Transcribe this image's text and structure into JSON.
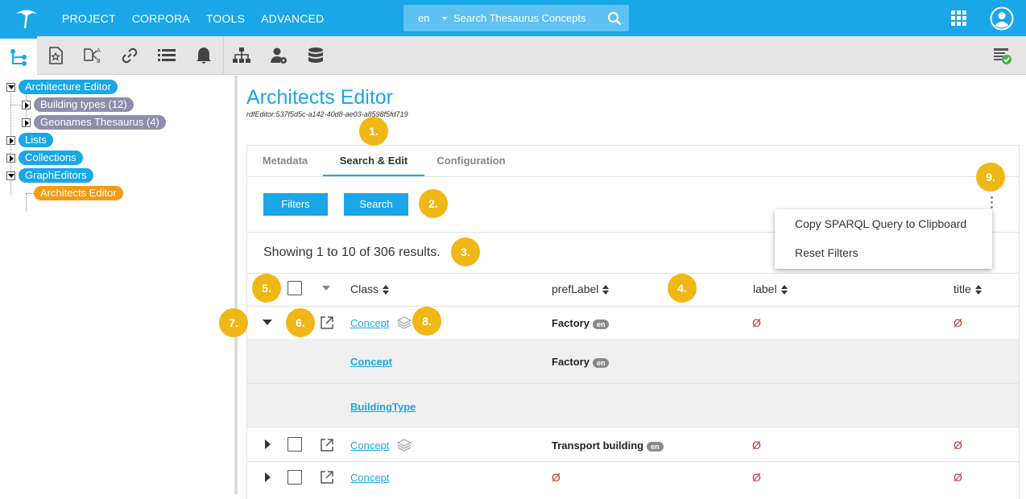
{
  "topnav": [
    "PROJECT",
    "CORPORA",
    "TOOLS",
    "ADVANCED"
  ],
  "search": {
    "lang": "en",
    "placeholder": "Search Thesaurus Concepts"
  },
  "tree": {
    "root": "Architecture Editor",
    "building_types": "Building types (12)",
    "geonames": "Geonames Thesaurus (4)",
    "lists": "Lists",
    "collections": "Collections",
    "graph_editors": "GraphEditors",
    "architects_editor": "Architects Editor"
  },
  "main": {
    "title": "Architects Editor",
    "subtitle": "rdfEditor:537f5d5c-a142-40d8-ae03-a8598f5fd719",
    "tabs": [
      "Metadata",
      "Search & Edit",
      "Configuration"
    ],
    "filters_label": "Filters",
    "search_label": "Search",
    "results": "Showing 1 to 10 of 306 results.",
    "menu": [
      "Copy SPARQL Query to Clipboard",
      "Reset Filters"
    ],
    "columns": [
      "Class",
      "prefLabel",
      "label",
      "title"
    ]
  },
  "rows": [
    {
      "class": "Concept",
      "pref": "Factory",
      "lang": "en",
      "label": "Ø",
      "title": "Ø"
    },
    {
      "class": "Concept",
      "pref": "Transport building",
      "lang": "en",
      "label": "Ø",
      "title": "Ø"
    },
    {
      "class": "Concept",
      "pref": "Ø",
      "label": "Ø",
      "title": "Ø"
    }
  ],
  "subrows": [
    {
      "class": "Concept",
      "pref": "Factory",
      "lang": "en"
    },
    {
      "class": "BuildingType"
    }
  ],
  "markers": [
    "1.",
    "2.",
    "3.",
    "4.",
    "5.",
    "6.",
    "7.",
    "8.",
    "9."
  ]
}
